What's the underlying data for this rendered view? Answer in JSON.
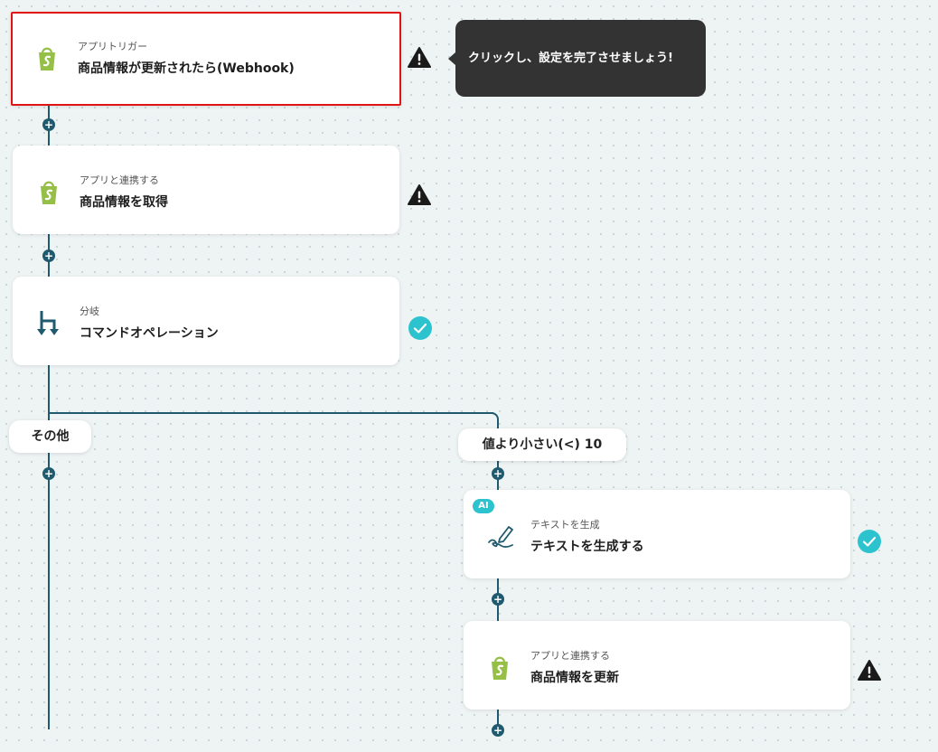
{
  "tooltip": {
    "text": "クリックし、設定を完了させましょう!"
  },
  "nodes": [
    {
      "sub": "アプリトリガー",
      "title": "商品情報が更新されたら(Webhook)",
      "icon": "shopify-icon",
      "status": "warning"
    },
    {
      "sub": "アプリと連携する",
      "title": "商品情報を取得",
      "icon": "shopify-icon",
      "status": "warning"
    },
    {
      "sub": "分岐",
      "title": "コマンドオペレーション",
      "icon": "branch-icon",
      "status": "complete"
    },
    {
      "sub": "テキストを生成",
      "title": "テキストを生成する",
      "icon": "pen-icon",
      "status": "complete",
      "badge": "AI"
    },
    {
      "sub": "アプリと連携する",
      "title": "商品情報を更新",
      "icon": "shopify-icon",
      "status": "warning"
    }
  ],
  "branches": {
    "other": "その他",
    "condition": "値より小さい(<) 10"
  },
  "add_step": "+",
  "colors": {
    "line": "#1f5a6e",
    "warning": "#1a1a1a",
    "complete": "#2cc3cf",
    "shopify": "#95bf47",
    "selected_border": "#e01414"
  }
}
